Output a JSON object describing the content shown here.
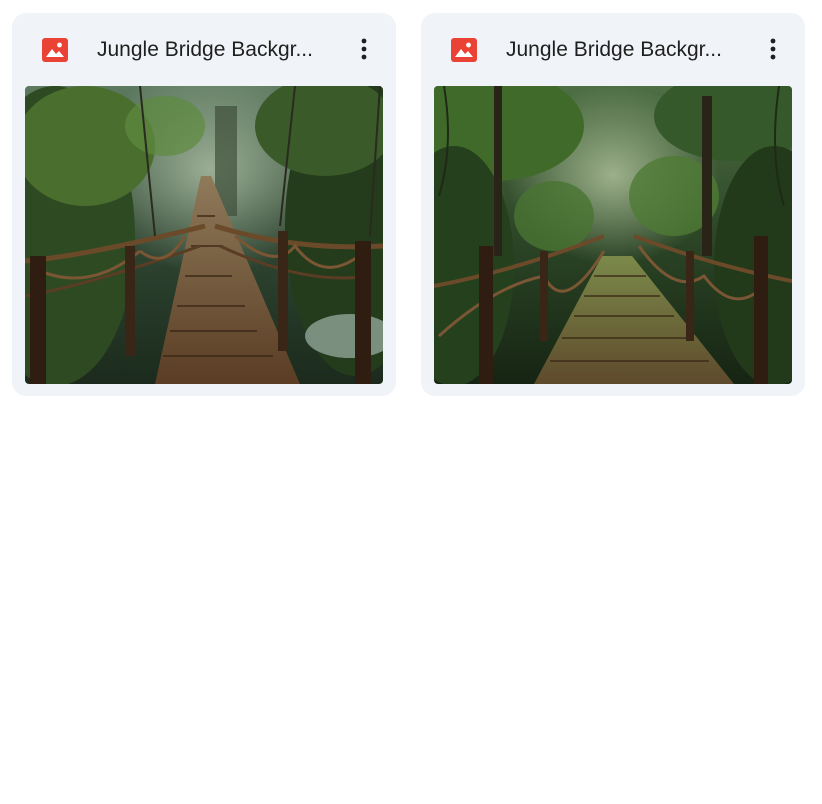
{
  "cards": [
    {
      "title": "Jungle Bridge Backgr...",
      "file_icon": "image-file-icon",
      "menu_icon": "more-vert-icon",
      "thumbnail": "jungle-rope-bridge-image-1"
    },
    {
      "title": "Jungle Bridge Backgr...",
      "file_icon": "image-file-icon",
      "menu_icon": "more-vert-icon",
      "thumbnail": "jungle-rope-bridge-image-2"
    }
  ],
  "colors": {
    "card_bg": "#f0f4f8",
    "image_icon": "#ea4335",
    "title_text": "#1f1f1f"
  }
}
